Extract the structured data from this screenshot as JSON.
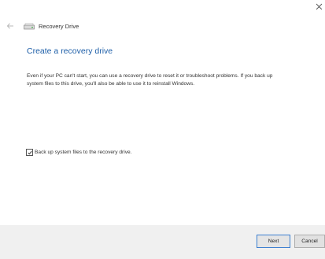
{
  "window": {
    "title": "Recovery Drive",
    "close_icon": "close-icon"
  },
  "nav": {
    "back_icon": "back-arrow-icon",
    "app_icon": "recovery-drive-icon"
  },
  "main": {
    "heading": "Create a recovery drive",
    "description": "Even if your PC can't start, you can use a recovery drive to reset it or troubleshoot problems. If you back up system files to this drive, you'll also be able to use it to reinstall Windows.",
    "checkbox": {
      "label": "Back up system files to the recovery drive.",
      "checked": true
    }
  },
  "footer": {
    "next_label": "Next",
    "cancel_label": "Cancel"
  },
  "colors": {
    "heading": "#1e5fa8",
    "default_button_border": "#3c7fd0",
    "footer_bg": "#f0f0f0"
  }
}
